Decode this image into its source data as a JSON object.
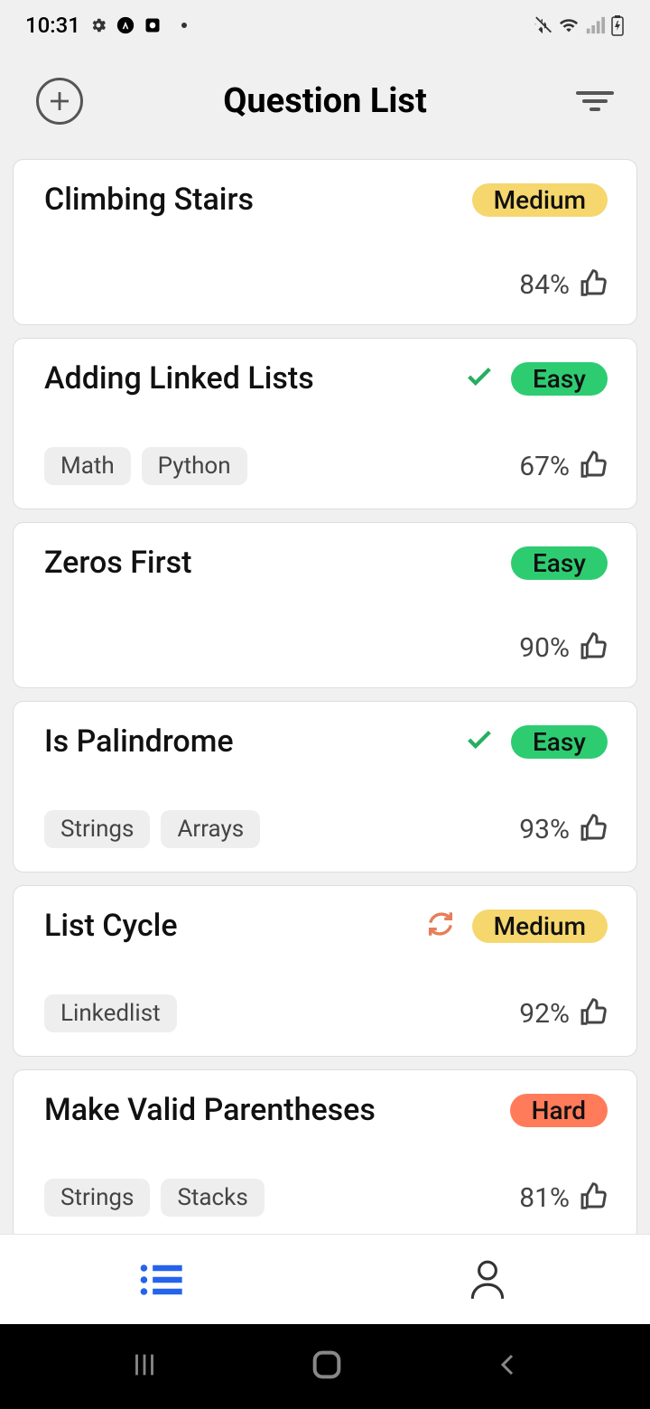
{
  "status": {
    "time": "10:31"
  },
  "header": {
    "title": "Question List"
  },
  "difficulty": {
    "easy": "Easy",
    "medium": "Medium",
    "hard": "Hard"
  },
  "items": [
    {
      "title": "Climbing Stairs",
      "difficulty": "medium",
      "pct": "84%",
      "tags": [],
      "status": "none"
    },
    {
      "title": "Adding Linked Lists",
      "difficulty": "easy",
      "pct": "67%",
      "tags": [
        "Math",
        "Python"
      ],
      "status": "done"
    },
    {
      "title": "Zeros First",
      "difficulty": "easy",
      "pct": "90%",
      "tags": [],
      "status": "none"
    },
    {
      "title": "Is Palindrome",
      "difficulty": "easy",
      "pct": "93%",
      "tags": [
        "Strings",
        "Arrays"
      ],
      "status": "done"
    },
    {
      "title": "List Cycle",
      "difficulty": "medium",
      "pct": "92%",
      "tags": [
        "Linkedlist"
      ],
      "status": "retry"
    },
    {
      "title": "Make Valid Parentheses",
      "difficulty": "hard",
      "pct": "81%",
      "tags": [
        "Strings",
        "Stacks"
      ],
      "status": "none"
    }
  ]
}
